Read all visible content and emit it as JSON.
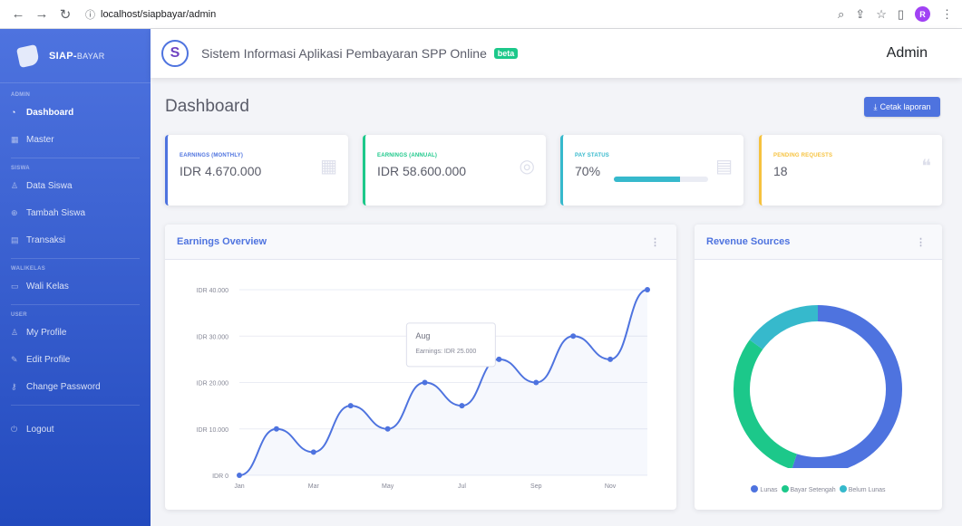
{
  "browser": {
    "url": "localhost/siapbayar/admin",
    "profile_initial": "R"
  },
  "sidebar": {
    "brand_bold": "SIAP-",
    "brand_thin": "BAYAR",
    "sections": [
      {
        "heading": "ADMIN",
        "items": [
          {
            "label": "Dashboard",
            "icon": "dashboard-icon",
            "active": true
          },
          {
            "label": "Master",
            "icon": "table-icon"
          }
        ]
      },
      {
        "heading": "SISWA",
        "items": [
          {
            "label": "Data Siswa",
            "icon": "user-icon"
          },
          {
            "label": "Tambah Siswa",
            "icon": "user-plus-icon"
          },
          {
            "label": "Transaksi",
            "icon": "receipt-icon"
          }
        ]
      },
      {
        "heading": "WALIKELAS",
        "items": [
          {
            "label": "Wali Kelas",
            "icon": "chalkboard-icon"
          }
        ]
      },
      {
        "heading": "USER",
        "items": [
          {
            "label": "My Profile",
            "icon": "user-icon"
          },
          {
            "label": "Edit Profile",
            "icon": "user-edit-icon"
          },
          {
            "label": "Change Password",
            "icon": "key-icon"
          }
        ]
      }
    ],
    "logout_label": "Logout"
  },
  "topbar": {
    "app_title": "Sistem Informasi Aplikasi Pembayaran SPP Online",
    "badge": "beta",
    "user": "Admin"
  },
  "page": {
    "title": "Dashboard",
    "cetak_label": "Cetak laporan"
  },
  "stats": [
    {
      "label": "EARNINGS (MONTHLY)",
      "value": "IDR 4.670.000",
      "color": "#4e73df",
      "icon": "calendar-icon"
    },
    {
      "label": "EARNINGS (ANNUAL)",
      "value": "IDR 58.600.000",
      "color": "#1cc88a",
      "icon": "coins-icon"
    },
    {
      "label": "PAY STATUS",
      "value": "70%",
      "color": "#36b9cc",
      "icon": "clipboard-icon",
      "progress": 70
    },
    {
      "label": "PENDING REQUESTS",
      "value": "18",
      "color": "#f6c23e",
      "icon": "comments-icon"
    }
  ],
  "earnings_card": {
    "title": "Earnings Overview",
    "tooltip_title": "Aug",
    "tooltip_text": "Earnings: IDR 25.000"
  },
  "revenue_card": {
    "title": "Revenue Sources",
    "legend": [
      "Lunas",
      "Bayar Setengah",
      "Belum Lunas"
    ]
  },
  "chart_data": [
    {
      "type": "line",
      "x": [
        "Jan",
        "Feb",
        "Mar",
        "Apr",
        "May",
        "Jun",
        "Jul",
        "Aug",
        "Sep",
        "Oct",
        "Nov",
        "Dec"
      ],
      "tick_labels_x": [
        "Jan",
        "Mar",
        "May",
        "Jul",
        "Sep",
        "Nov"
      ],
      "series": [
        {
          "name": "Earnings",
          "values": [
            0,
            10000,
            5000,
            15000,
            10000,
            20000,
            15000,
            25000,
            20000,
            30000,
            25000,
            40000
          ]
        }
      ],
      "y_ticks": [
        "IDR 0",
        "IDR 10.000",
        "IDR 20.000",
        "IDR 30.000",
        "IDR 40.000"
      ],
      "ylim": [
        0,
        40000
      ],
      "color": "#4e73df",
      "grid": true
    },
    {
      "type": "pie",
      "categories": [
        "Lunas",
        "Bayar Setengah",
        "Belum Lunas"
      ],
      "values": [
        55,
        30,
        15
      ],
      "colors": [
        "#4e73df",
        "#1cc88a",
        "#36b9cc"
      ],
      "donut": true,
      "legend_position": "bottom"
    }
  ]
}
